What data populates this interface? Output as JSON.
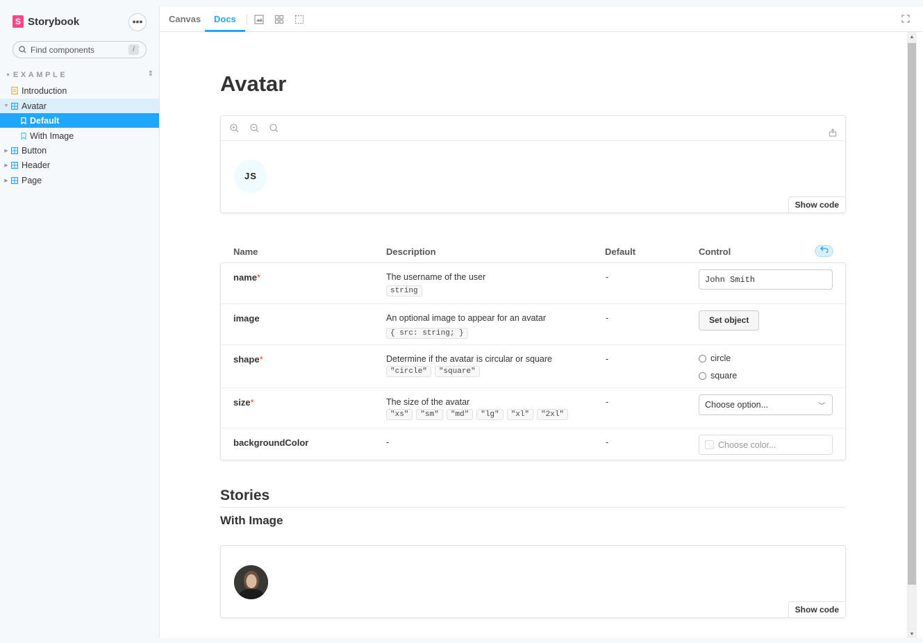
{
  "sidebar": {
    "brand": "Storybook",
    "menu_label": "•••",
    "search_placeholder": "Find components",
    "search_shortcut": "/",
    "section": "EXAMPLE",
    "items": [
      {
        "label": "Introduction",
        "type": "doc"
      },
      {
        "label": "Avatar",
        "type": "component"
      },
      {
        "label": "Default",
        "type": "story"
      },
      {
        "label": "With Image",
        "type": "story"
      },
      {
        "label": "Button",
        "type": "component"
      },
      {
        "label": "Header",
        "type": "component"
      },
      {
        "label": "Page",
        "type": "component"
      }
    ]
  },
  "toolbar": {
    "tabs": [
      {
        "label": "Canvas",
        "active": false
      },
      {
        "label": "Docs",
        "active": true
      }
    ]
  },
  "doc": {
    "title": "Avatar",
    "avatar_initials": "JS",
    "show_code": "Show code"
  },
  "args": {
    "headers": {
      "name": "Name",
      "description": "Description",
      "default": "Default",
      "control": "Control"
    },
    "rows": [
      {
        "name": "name",
        "required": "*",
        "description": "The username of the user",
        "types": [
          "string"
        ],
        "default": "-",
        "control_value": "John Smith"
      },
      {
        "name": "image",
        "required": "",
        "description": "An optional image to appear for an avatar",
        "types": [
          "{ src: string; }"
        ],
        "default": "-",
        "control_label": "Set object"
      },
      {
        "name": "shape",
        "required": "*",
        "description": "Determine if the avatar is circular or square",
        "types": [
          "\"circle\"",
          "\"square\""
        ],
        "default": "-",
        "options": [
          "circle",
          "square"
        ]
      },
      {
        "name": "size",
        "required": "*",
        "description": "The size of the avatar",
        "types": [
          "\"xs\"",
          "\"sm\"",
          "\"md\"",
          "\"lg\"",
          "\"xl\"",
          "\"2xl\""
        ],
        "default": "-",
        "control_placeholder": "Choose option..."
      },
      {
        "name": "backgroundColor",
        "required": "",
        "description": "-",
        "types": [],
        "default": "-",
        "control_placeholder": "Choose color..."
      }
    ]
  },
  "stories": {
    "title": "Stories",
    "story_title": "With Image",
    "show_code": "Show code"
  },
  "colors": {
    "accent": "#1ea7fd",
    "brand": "#ff4785",
    "required": "#ff4400"
  }
}
